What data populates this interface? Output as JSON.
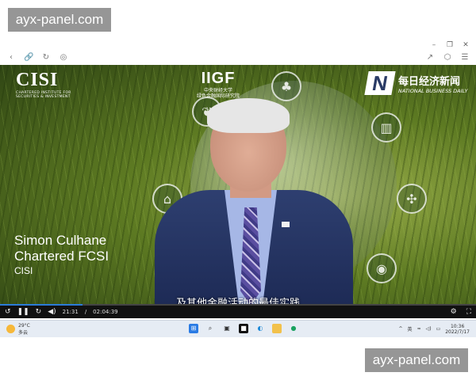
{
  "watermark": {
    "top_text": "ayx-panel.com",
    "bottom_text": "ayx-panel.com"
  },
  "window_controls": {
    "minimize": "–",
    "restore": "❐",
    "close": "✕"
  },
  "browser": {
    "left_icons": [
      "back-icon",
      "link-icon",
      "refresh-icon",
      "globe-icon"
    ],
    "right_icons": [
      "share-icon",
      "cube-icon",
      "menu-icon"
    ]
  },
  "video": {
    "logos": {
      "cisi": "CISI",
      "cisi_full": "CHARTERED INSTITUTE FOR SECURITIES & INVESTMENT",
      "iigf": "IIGF",
      "iigf_cn": "中央财经大学",
      "iigf_cn2": "绿色金融国际研究院",
      "nbd_cn": "每日经济新闻",
      "nbd_en": "NATIONAL BUSINESS DAILY"
    },
    "speaker_name": "Simon Culhane",
    "speaker_title": "Chartered FCSI",
    "speaker_org": "CISI",
    "subtitle": "及其他金融活动的最佳实践"
  },
  "player": {
    "current_time": "21:31",
    "duration": "02:04:39",
    "progress": 0.173
  },
  "taskbar": {
    "temperature": "29°C",
    "weather": "多云",
    "ime": "英",
    "time": "10:36",
    "date": "2022/7/17"
  }
}
